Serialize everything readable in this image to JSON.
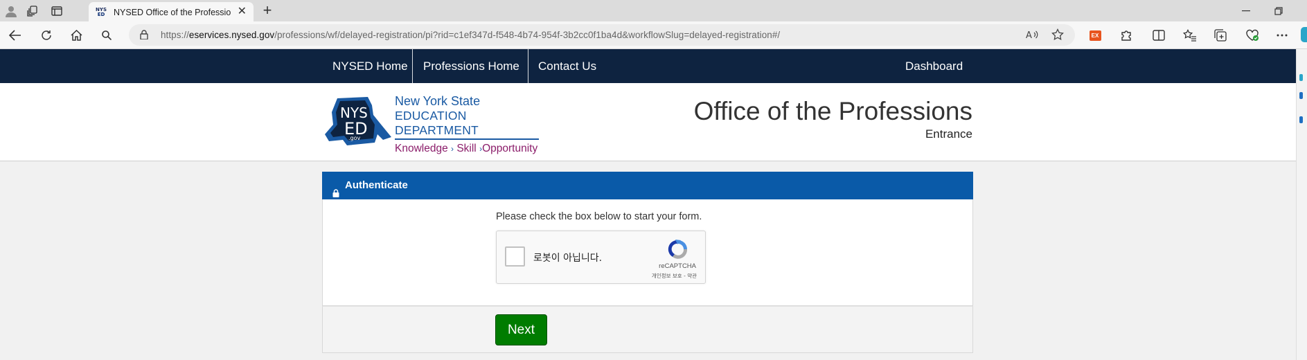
{
  "browser": {
    "tab": {
      "title": "NYSED Office of the Professions",
      "favicon_text": [
        "NYS",
        "ED"
      ]
    },
    "address": {
      "url_prefix": "https://",
      "url_host": "eservices.nysed.gov",
      "url_path": "/professions/wf/delayed-registration/pi?rid=c1ef347d-f548-4b74-954f-3b2cc0f1ba4d&workflowSlug=delayed-registration#/"
    },
    "extension_badge": "EX"
  },
  "site_nav": {
    "items": [
      "NYSED Home",
      "Professions Home",
      "Contact Us"
    ],
    "dashboard": "Dashboard"
  },
  "header": {
    "logo": {
      "badge_top": "NYS",
      "badge_bottom": "ED",
      "badge_domain": ".gov",
      "line1": "New York State",
      "line2": "EDUCATION DEPARTMENT",
      "tagline": [
        "Knowledge",
        "Skill",
        "Opportunity"
      ]
    },
    "title": "Office of the Professions",
    "subtitle": "Entrance"
  },
  "auth_card": {
    "heading": "Authenticate",
    "instruction": "Please check the box below to start your form.",
    "recaptcha": {
      "label": "로봇이 아닙니다.",
      "brand": "reCAPTCHA",
      "privacy": "개인정보 보호",
      "terms": "약관"
    },
    "next_label": "Next"
  },
  "colors": {
    "nav_bg": "#0e2340",
    "card_header": "#0a5aa8",
    "next_button": "#007c00",
    "logo_blue": "#1a5aa3",
    "logo_purple": "#8b1d6a"
  }
}
